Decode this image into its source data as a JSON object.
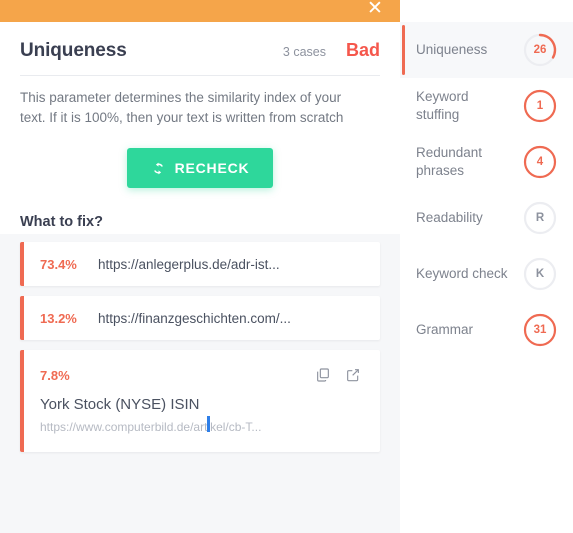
{
  "topbar": {
    "close_label": "✕"
  },
  "header": {
    "title": "Uniqueness",
    "cases": "3 cases",
    "verdict": "Bad",
    "verdict_color": "#f5574c"
  },
  "description": "This parameter determines the similarity index of your text. If it is 100%, then your text is written from scratch",
  "recheck": {
    "label": "RECHECK",
    "icon": "refresh-icon",
    "color": "#2ed79b"
  },
  "what_to_fix": {
    "heading": "What to fix?"
  },
  "results": [
    {
      "percent": "73.4%",
      "url": "https://anlegerplus.de/adr-ist...",
      "expanded": false
    },
    {
      "percent": "13.2%",
      "url": "https://finanzgeschichten.com/...",
      "expanded": false
    },
    {
      "percent": "7.8%",
      "title": "York Stock (NYSE) ISIN",
      "url": "https://www.computerbild.de/artikel/cb-T...",
      "expanded": true,
      "copy_icon": "copy-icon",
      "open_icon": "external-link-icon"
    }
  ],
  "sidebar": {
    "items": [
      {
        "label": "Uniqueness",
        "badge": "26",
        "badge_style": "arc",
        "active": true
      },
      {
        "label": "Keyword stuffing",
        "badge": "1",
        "badge_style": "full-red",
        "active": false
      },
      {
        "label": "Redundant phrases",
        "badge": "4",
        "badge_style": "full-red",
        "active": false
      },
      {
        "label": "Readability",
        "badge": "R",
        "badge_style": "gray",
        "active": false
      },
      {
        "label": "Keyword check",
        "badge": "K",
        "badge_style": "gray",
        "active": false
      },
      {
        "label": "Grammar",
        "badge": "31",
        "badge_style": "full-red",
        "active": false
      }
    ]
  },
  "colors": {
    "accent_orange": "#f5a54a",
    "accent_red": "#ef6a52",
    "accent_green": "#2ed79b",
    "panel_bg": "#f6f7f9"
  }
}
